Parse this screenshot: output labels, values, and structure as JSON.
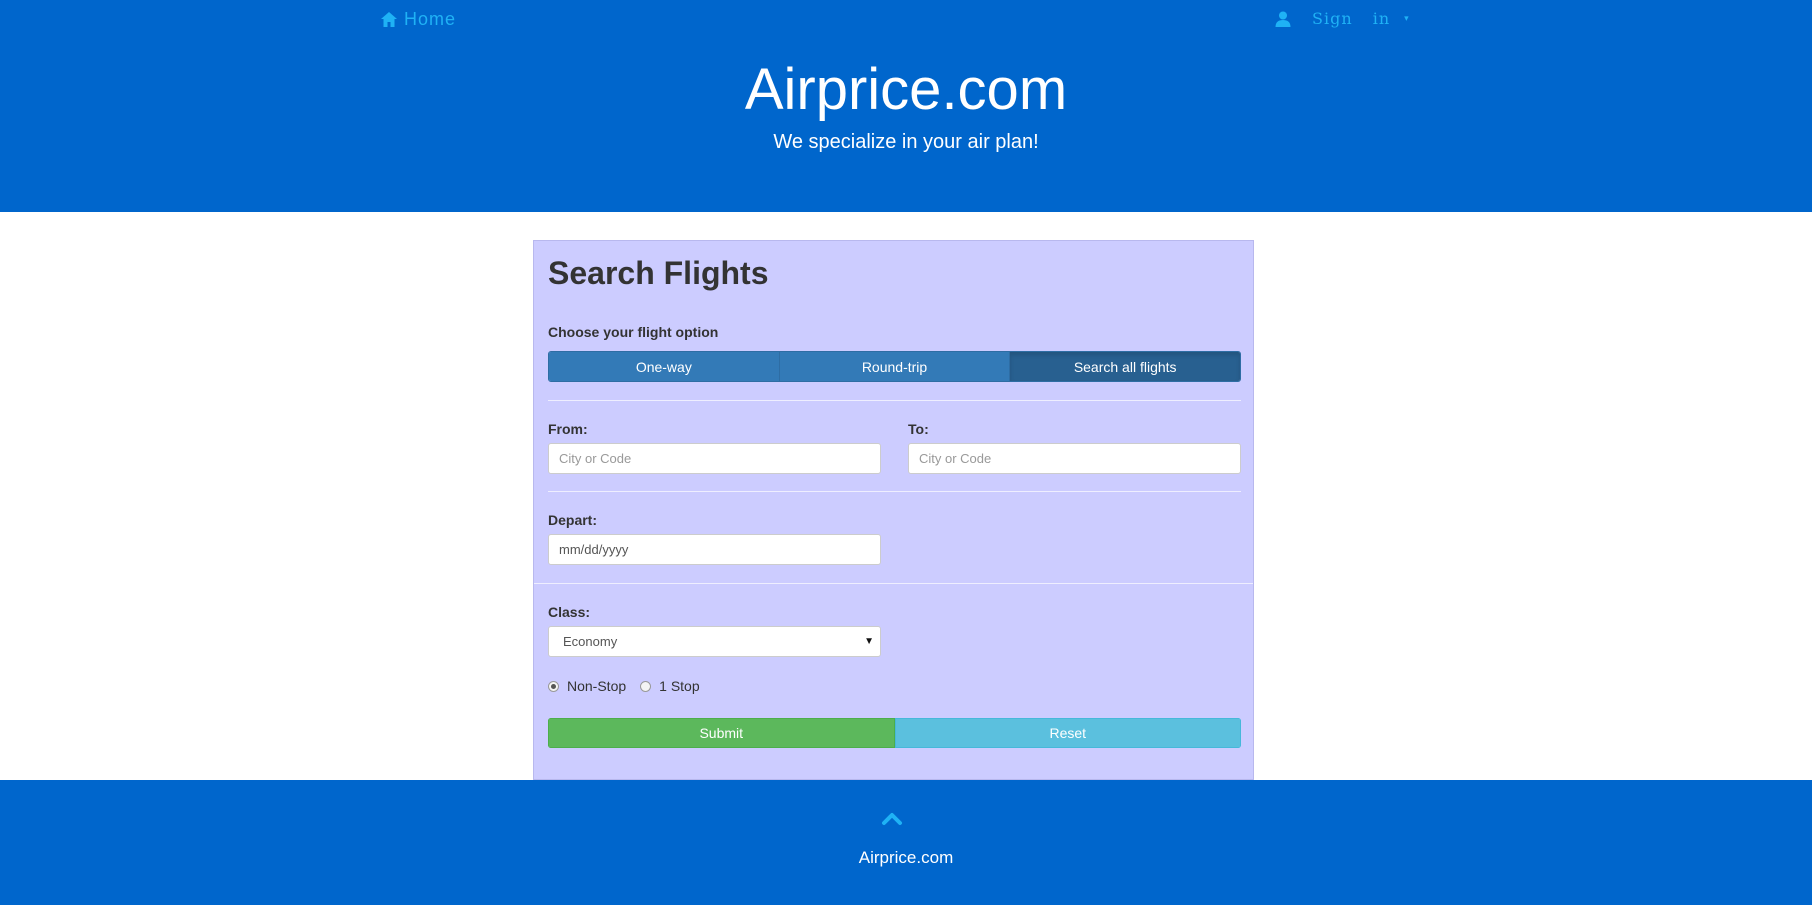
{
  "nav": {
    "home_label": "Home",
    "home_icon": "home-icon",
    "signin_label": "Sign in",
    "signin_icon": "user-icon",
    "signin_caret": "▾",
    "link_color": "#1fb2f5"
  },
  "header": {
    "title": "Airprice.com",
    "tagline": "We specialize in your air plan!",
    "background": "#0066cc"
  },
  "search": {
    "title": "Search Flights",
    "option_label": "Choose your flight option",
    "options": [
      {
        "label": "One-way",
        "active": false
      },
      {
        "label": "Round-trip",
        "active": false
      },
      {
        "label": "Search all flights",
        "active": true
      }
    ],
    "from_label": "From:",
    "from_placeholder": "City or Code",
    "to_label": "To:",
    "to_placeholder": "City or Code",
    "depart_label": "Depart:",
    "depart_placeholder": "mm/dd/yyyy",
    "class_label": "Class:",
    "class_value": "Economy",
    "class_arrow": "▼",
    "stops": [
      {
        "label": "Non-Stop",
        "checked": true
      },
      {
        "label": "1 Stop",
        "checked": false
      }
    ],
    "submit_label": "Submit",
    "reset_label": "Reset",
    "panel_color": "#ccccff"
  },
  "footer": {
    "up_icon": "chevron-up-icon",
    "text": "Airprice.com"
  }
}
